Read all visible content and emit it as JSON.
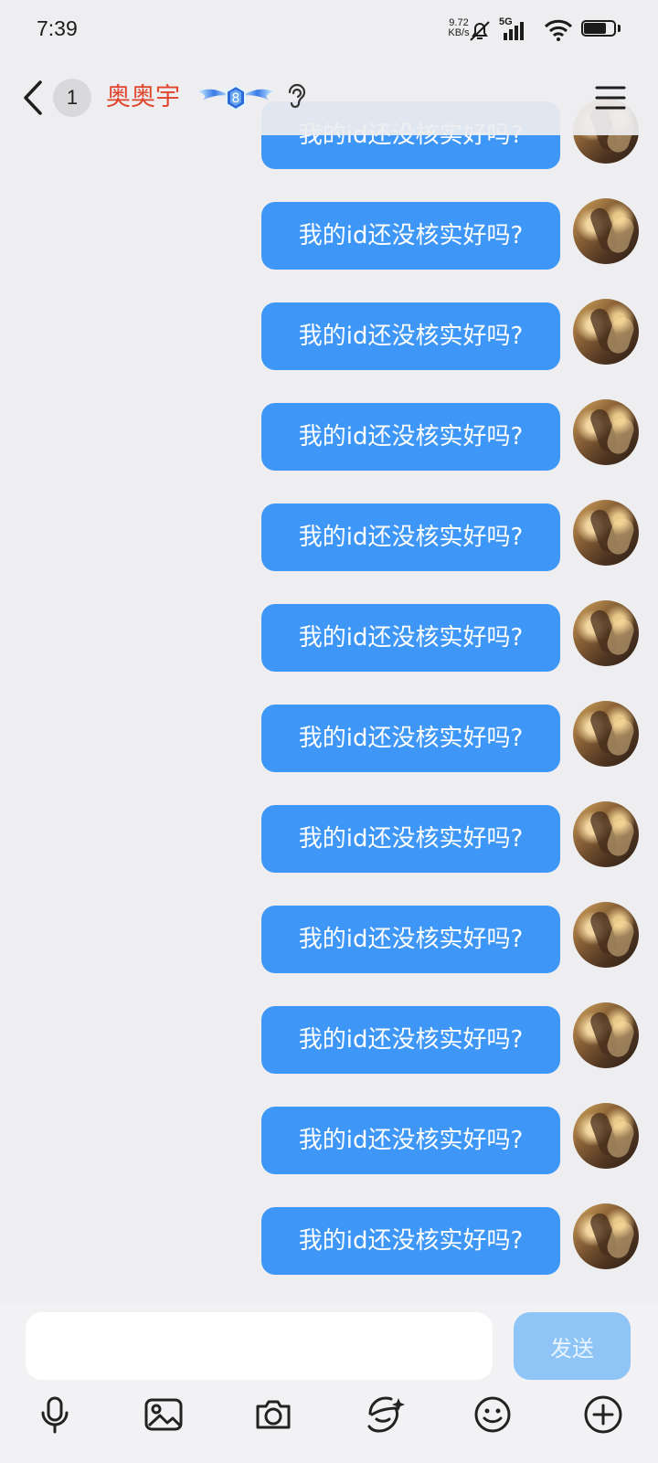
{
  "status_bar": {
    "time": "7:39",
    "net_speed_value": "9.72",
    "net_speed_unit": "KB/s",
    "network_type": "5G",
    "battery_level": "71",
    "battery_fraction": 0.71
  },
  "header": {
    "unread_count": "1",
    "contact_name": "奥奥宇",
    "badge_level": "8"
  },
  "messages": [
    "我的id还没核实好吗?",
    "我的id还没核实好吗?",
    "我的id还没核实好吗?",
    "我的id还没核实好吗?",
    "我的id还没核实好吗?",
    "我的id还没核实好吗?",
    "我的id还没核实好吗?",
    "我的id还没核实好吗?",
    "我的id还没核实好吗?",
    "我的id还没核实好吗?",
    "我的id还没核实好吗?",
    "我的id还没核实好吗?"
  ],
  "input": {
    "value": "",
    "send_label": "发送"
  },
  "toolbar": {
    "icons": [
      "microphone-icon",
      "image-icon",
      "camera-icon",
      "sticker-icon",
      "emoji-icon",
      "plus-icon"
    ]
  },
  "colors": {
    "bubble": "#3e97f6",
    "name": "#e0452c",
    "send_disabled": "#8fc4f7"
  }
}
